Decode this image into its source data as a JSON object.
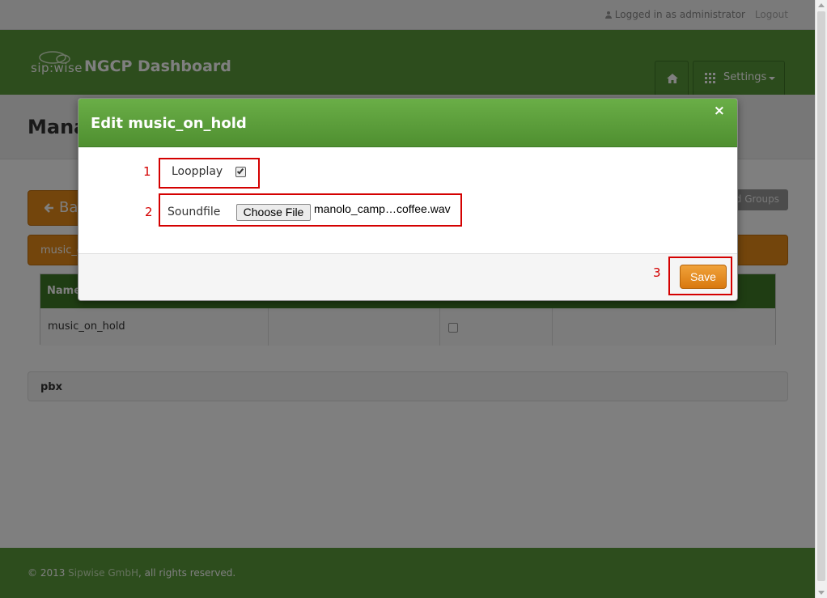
{
  "topbar": {
    "logged_in_text": "Logged in as administrator",
    "logout_label": "Logout"
  },
  "header": {
    "brand_text": "sip:wise",
    "app_title": "NGCP Dashboard",
    "settings_label": "Settings",
    "home_icon": "home-icon",
    "settings_icon": "grid-icon"
  },
  "page": {
    "title_partial": "Mana",
    "back_label": "Ba",
    "groups_button_partial": "d Groups",
    "accordion_label_partial": "music_o",
    "table_header_partial": "Name",
    "table_row_name": "music_on_hold",
    "pbx_section_label": "pbx"
  },
  "footer": {
    "copyright_prefix": "© 2013 ",
    "company": "Sipwise GmbH",
    "copyright_suffix": ", all rights reserved."
  },
  "modal": {
    "title": "Edit music_on_hold",
    "close_symbol": "×",
    "loopplay_label": "Loopplay",
    "loopplay_checked": true,
    "soundfile_label": "Soundfile",
    "choose_file_label": "Choose File",
    "file_name": "manolo_camp…coffee.wav",
    "save_label": "Save"
  },
  "annotations": {
    "n1": "1",
    "n2": "2",
    "n3": "3",
    "color": "#d40000"
  },
  "colors": {
    "brand_green": "#5a9a3a",
    "accent_orange": "#e68a19"
  }
}
